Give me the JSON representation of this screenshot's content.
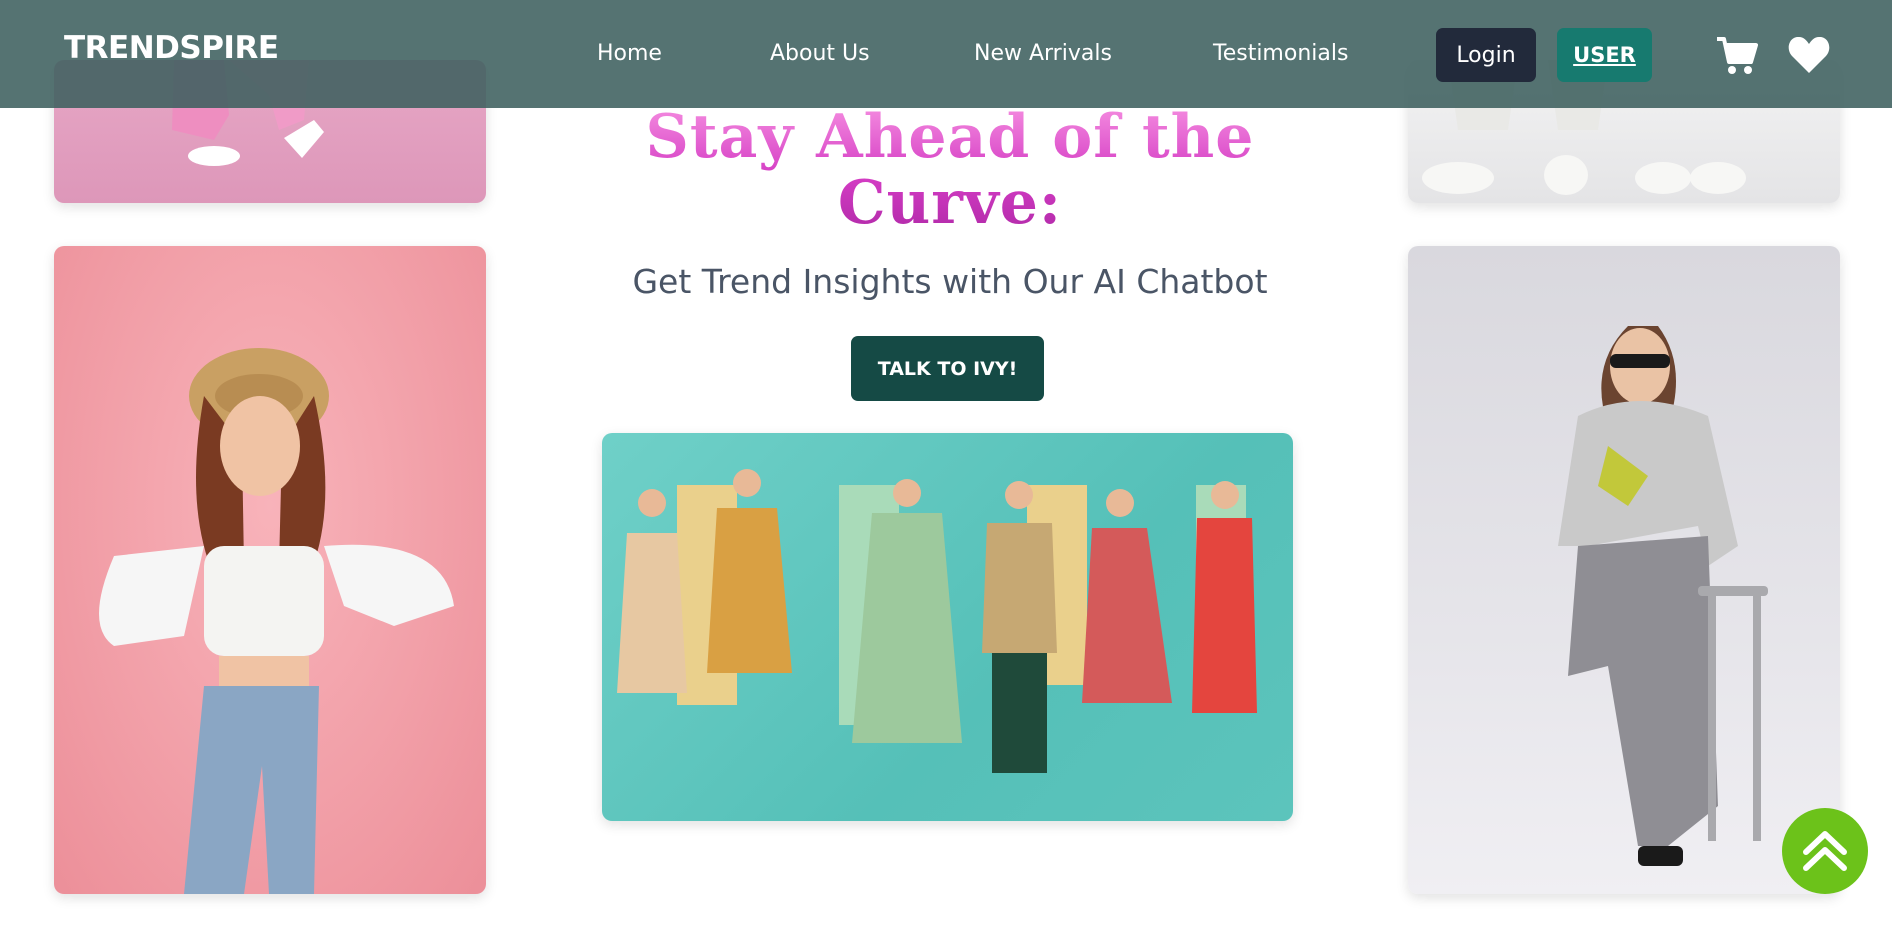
{
  "nav": {
    "brand": "TRENDSPIRE",
    "links": [
      "Home",
      "About Us",
      "New Arrivals",
      "Testimonials"
    ],
    "login_label": "Login",
    "user_label": "USER",
    "cart_icon": "cart-icon",
    "heart_icon": "heart-icon"
  },
  "hero": {
    "headline": "Stay Ahead of the Curve:",
    "subheadline": "Get Trend Insights with Our AI Chatbot",
    "cta_label": "TALK TO IVY!"
  },
  "images": {
    "top_left": "fashion-photo",
    "left": "fashion-photo",
    "center": "fashion-group-photo",
    "top_right": "fashion-photo",
    "right": "fashion-photo"
  },
  "scroll_top_icon": "double-chevron-up-icon",
  "colors": {
    "nav_bg": "#3e605e",
    "login_bg": "#222a3b",
    "user_bg": "#177a6f",
    "cta_bg": "#154a45",
    "headline": "#d63fc5",
    "scroll_top_bg": "#6cc21a"
  }
}
